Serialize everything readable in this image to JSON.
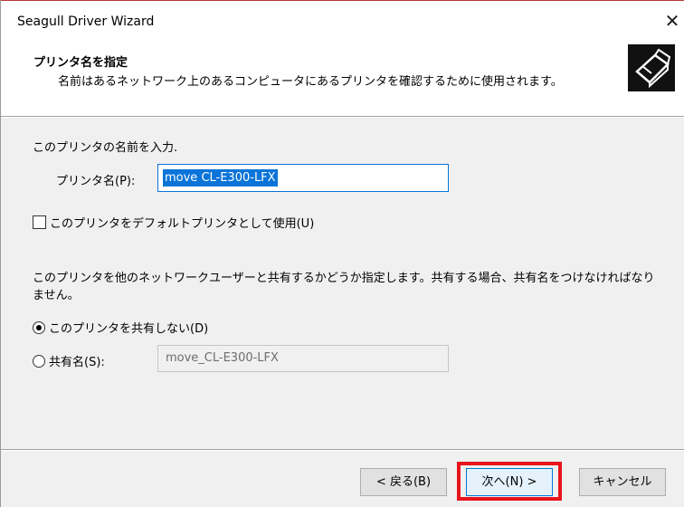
{
  "window": {
    "title": "Seagull Driver Wizard",
    "close_symbol": "✕"
  },
  "header": {
    "title": "プリンタ名を指定",
    "subtitle": "名前はあるネットワーク上のあるコンピュータにあるプリンタを確認するために使用されます。",
    "icon": "printer-icon"
  },
  "form": {
    "enter_name_label": "このプリンタの名前を入力.",
    "printer_name_label": "プリンタ名(P):",
    "printer_name_value": "move CL-E300-LFX",
    "default_checkbox_label": "このプリンタをデフォルトプリンタとして使用(U)",
    "default_checked": false,
    "share_description": "このプリンタを他のネットワークユーザーと共有するかどうか指定します。共有する場合、共有名をつけなければなりません。",
    "no_share_label": "このプリンタを共有しない(D)",
    "share_label": "共有名(S):",
    "share_name_value": "move_CL-E300-LFX",
    "selected_option": "no_share"
  },
  "footer": {
    "back_label": "< 戻る(B)",
    "next_label": "次へ(N) >",
    "cancel_label": "キャンセル"
  },
  "colors": {
    "highlight": "#e8141c",
    "selection": "#0a74d8"
  }
}
